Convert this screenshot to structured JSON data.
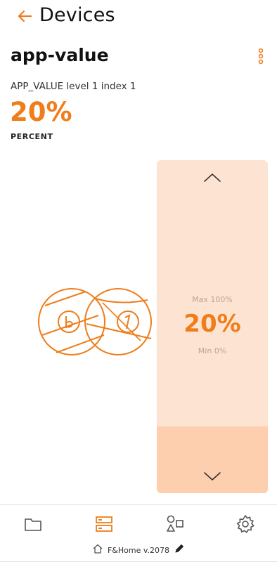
{
  "header": {
    "title": "Devices",
    "back_icon": "arrow-left-icon"
  },
  "device": {
    "name": "app-value",
    "subtitle": "APP_VALUE level 1 index 1",
    "value": "20%",
    "unit": "PERCENT"
  },
  "slider": {
    "max_label": "Max 100%",
    "min_label": "Min 0%",
    "value_label": "20%",
    "level": 0.2,
    "up_icon": "chevron-up-icon",
    "down_icon": "chevron-down-icon"
  },
  "nav": {
    "items": [
      {
        "name": "folder",
        "icon": "folder-icon",
        "active": false
      },
      {
        "name": "devices",
        "icon": "server-icon",
        "active": true
      },
      {
        "name": "shapes",
        "icon": "shapes-icon",
        "active": false
      },
      {
        "name": "settings",
        "icon": "gear-icon",
        "active": false
      }
    ]
  },
  "footer": {
    "text": "F&Home v.2078",
    "home_icon": "home-icon",
    "edit_icon": "pencil-icon"
  },
  "colors": {
    "accent": "#ef7d1a",
    "slider_bg": "#fde4d2",
    "slider_fill": "#fdcfae"
  }
}
